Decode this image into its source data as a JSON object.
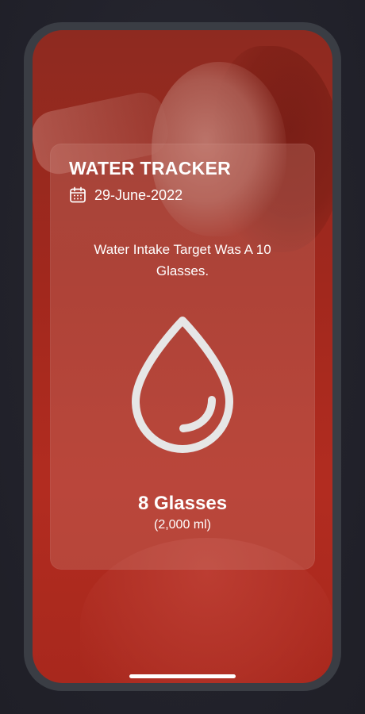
{
  "app": {
    "title": "WATER TRACKER",
    "date": "29-June-2022",
    "target_message": "Water Intake Target Was A 10 Glasses.",
    "intake_count": "8 Glasses",
    "intake_volume": "(2,000 ml)"
  },
  "icons": {
    "calendar": "calendar-icon",
    "drop": "water-drop-icon"
  },
  "colors": {
    "background": "#24232d",
    "frame": "#3a3d44",
    "screen_red": "#a8281d",
    "text": "#ffffff",
    "drop_stroke": "#e6e6e6"
  }
}
